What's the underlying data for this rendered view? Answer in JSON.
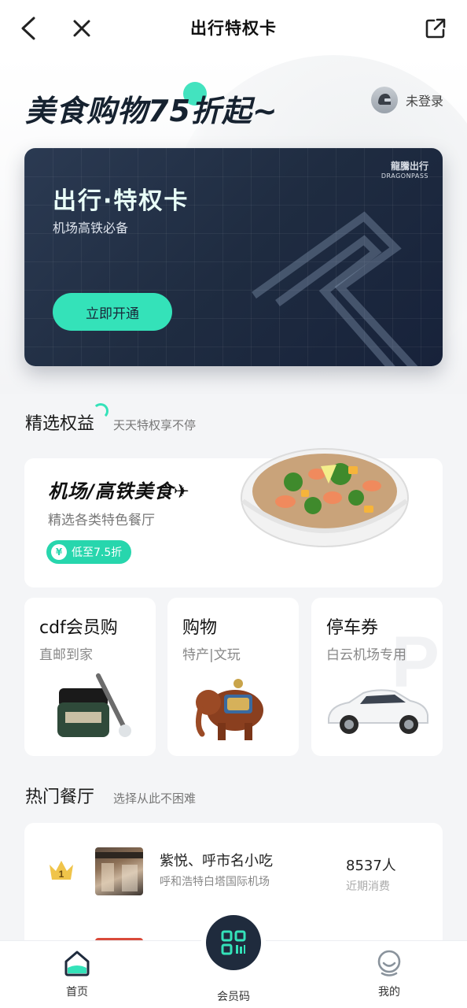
{
  "nav": {
    "title": "出行特权卡",
    "icons": [
      "back-arrow-icon",
      "close-icon",
      "share-icon"
    ]
  },
  "hero": {
    "slogan": "美食购物75折起~",
    "login_text": "未登录",
    "card": {
      "brand_cn": "龍騰出行",
      "brand_en": "DRAGONPASS",
      "title": "出行·特权卡",
      "subtitle": "机场高铁必备",
      "cta": "立即开通"
    },
    "accent_color": "#34e2b9"
  },
  "benefits": {
    "title": "精选权益",
    "subtitle": "天天特权享不停",
    "food": {
      "title": "机场/高铁美食✈",
      "subtitle": "精选各类特色餐厅",
      "badge_icon": "¥",
      "badge": "低至7.5折"
    },
    "cards": [
      {
        "title": "cdf会员购",
        "subtitle": "直邮到家"
      },
      {
        "title": "购物",
        "subtitle": "特产|文玩"
      },
      {
        "title": "停车券",
        "subtitle": "白云机场专用",
        "watermark": "P"
      }
    ]
  },
  "restaurants": {
    "title": "热门餐厅",
    "subtitle": "选择从此不困难",
    "items": [
      {
        "rank": "1",
        "name": "紫悦、呼市名小吃",
        "location": "呼和浩特白塔国际机场",
        "count": "8537人",
        "count_label": "近期消费"
      }
    ]
  },
  "tabbar": {
    "items": [
      {
        "label": "首页",
        "icon": "home-icon",
        "active": true
      },
      {
        "label": "会员码",
        "icon": "qr-code-icon",
        "active": false
      },
      {
        "label": "我的",
        "icon": "profile-icon",
        "active": false
      }
    ]
  }
}
